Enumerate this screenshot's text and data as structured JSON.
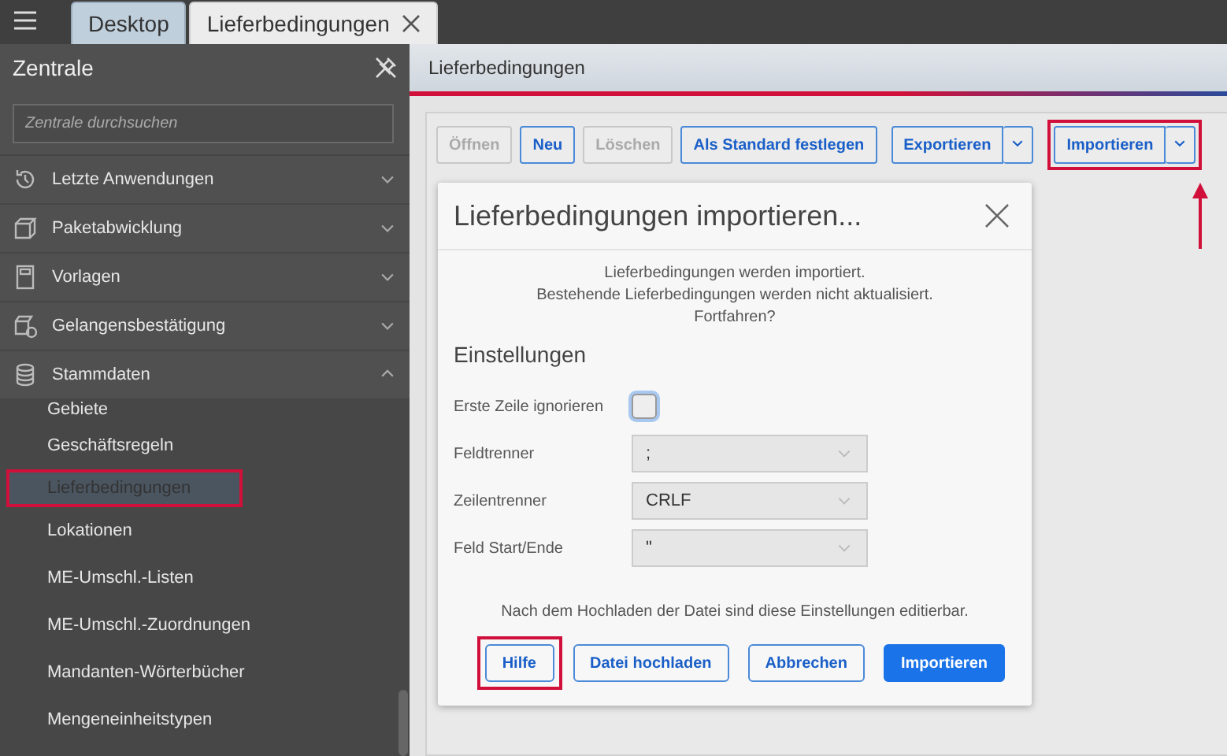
{
  "tabs": [
    {
      "label": "Desktop",
      "selected": false,
      "closable": false
    },
    {
      "label": "Lieferbedingungen",
      "selected": true,
      "closable": true
    }
  ],
  "sidebar": {
    "title": "Zentrale",
    "search": {
      "placeholder": "Zentrale durchsuchen"
    },
    "groups": [
      {
        "label": "Letzte Anwendungen",
        "expanded": false
      },
      {
        "label": "Paketabwicklung",
        "expanded": false
      },
      {
        "label": "Vorlagen",
        "expanded": false
      },
      {
        "label": "Gelangensbestätigung",
        "expanded": false
      },
      {
        "label": "Stammdaten",
        "expanded": true
      }
    ],
    "items": [
      {
        "label": "Gebiete",
        "selected": false,
        "highlighted": false
      },
      {
        "label": "Geschäftsregeln",
        "selected": false,
        "highlighted": false
      },
      {
        "label": "Lieferbedingungen",
        "selected": true,
        "highlighted": true
      },
      {
        "label": "Lokationen",
        "selected": false,
        "highlighted": false
      },
      {
        "label": "ME-Umschl.-Listen",
        "selected": false,
        "highlighted": false
      },
      {
        "label": "ME-Umschl.-Zuordnungen",
        "selected": false,
        "highlighted": false
      },
      {
        "label": "Mandanten-Wörterbücher",
        "selected": false,
        "highlighted": false
      },
      {
        "label": "Mengeneinheitstypen",
        "selected": false,
        "highlighted": false
      }
    ]
  },
  "page": {
    "title": "Lieferbedingungen",
    "toolbar": [
      {
        "label": "Öffnen",
        "kind": "plain",
        "disabled": true,
        "highlighted": false
      },
      {
        "label": "Neu",
        "kind": "plain",
        "disabled": false,
        "highlighted": false
      },
      {
        "label": "Löschen",
        "kind": "plain",
        "disabled": true,
        "highlighted": false
      },
      {
        "label": "Als Standard festlegen",
        "kind": "plain",
        "disabled": false,
        "highlighted": false
      },
      {
        "label": "Exportieren",
        "kind": "split",
        "disabled": false,
        "highlighted": false
      },
      {
        "label": "Importieren",
        "kind": "split",
        "disabled": false,
        "highlighted": true
      }
    ]
  },
  "dialog": {
    "title": "Lieferbedingungen importieren...",
    "message": [
      "Lieferbedingungen werden importiert.",
      "Bestehende Lieferbedingungen werden nicht aktualisiert.",
      "Fortfahren?"
    ],
    "section": "Einstellungen",
    "settings": [
      {
        "kind": "checkbox",
        "label": "Erste Zeile ignorieren",
        "checked": false
      },
      {
        "kind": "select",
        "label": "Feldtrenner",
        "value": ";",
        "disabled": true
      },
      {
        "kind": "select",
        "label": "Zeilentrenner",
        "value": "CRLF",
        "disabled": true
      },
      {
        "kind": "select",
        "label": "Feld Start/Ende",
        "value": "\"",
        "disabled": true
      }
    ],
    "note": "Nach dem Hochladen der Datei sind diese Einstellungen editierbar.",
    "buttons": [
      {
        "label": "Hilfe",
        "primary": false,
        "highlighted": true
      },
      {
        "label": "Datei hochladen",
        "primary": false,
        "highlighted": false
      },
      {
        "label": "Abbrechen",
        "primary": false,
        "highlighted": false
      },
      {
        "label": "Importieren",
        "primary": true,
        "highlighted": false
      }
    ]
  }
}
